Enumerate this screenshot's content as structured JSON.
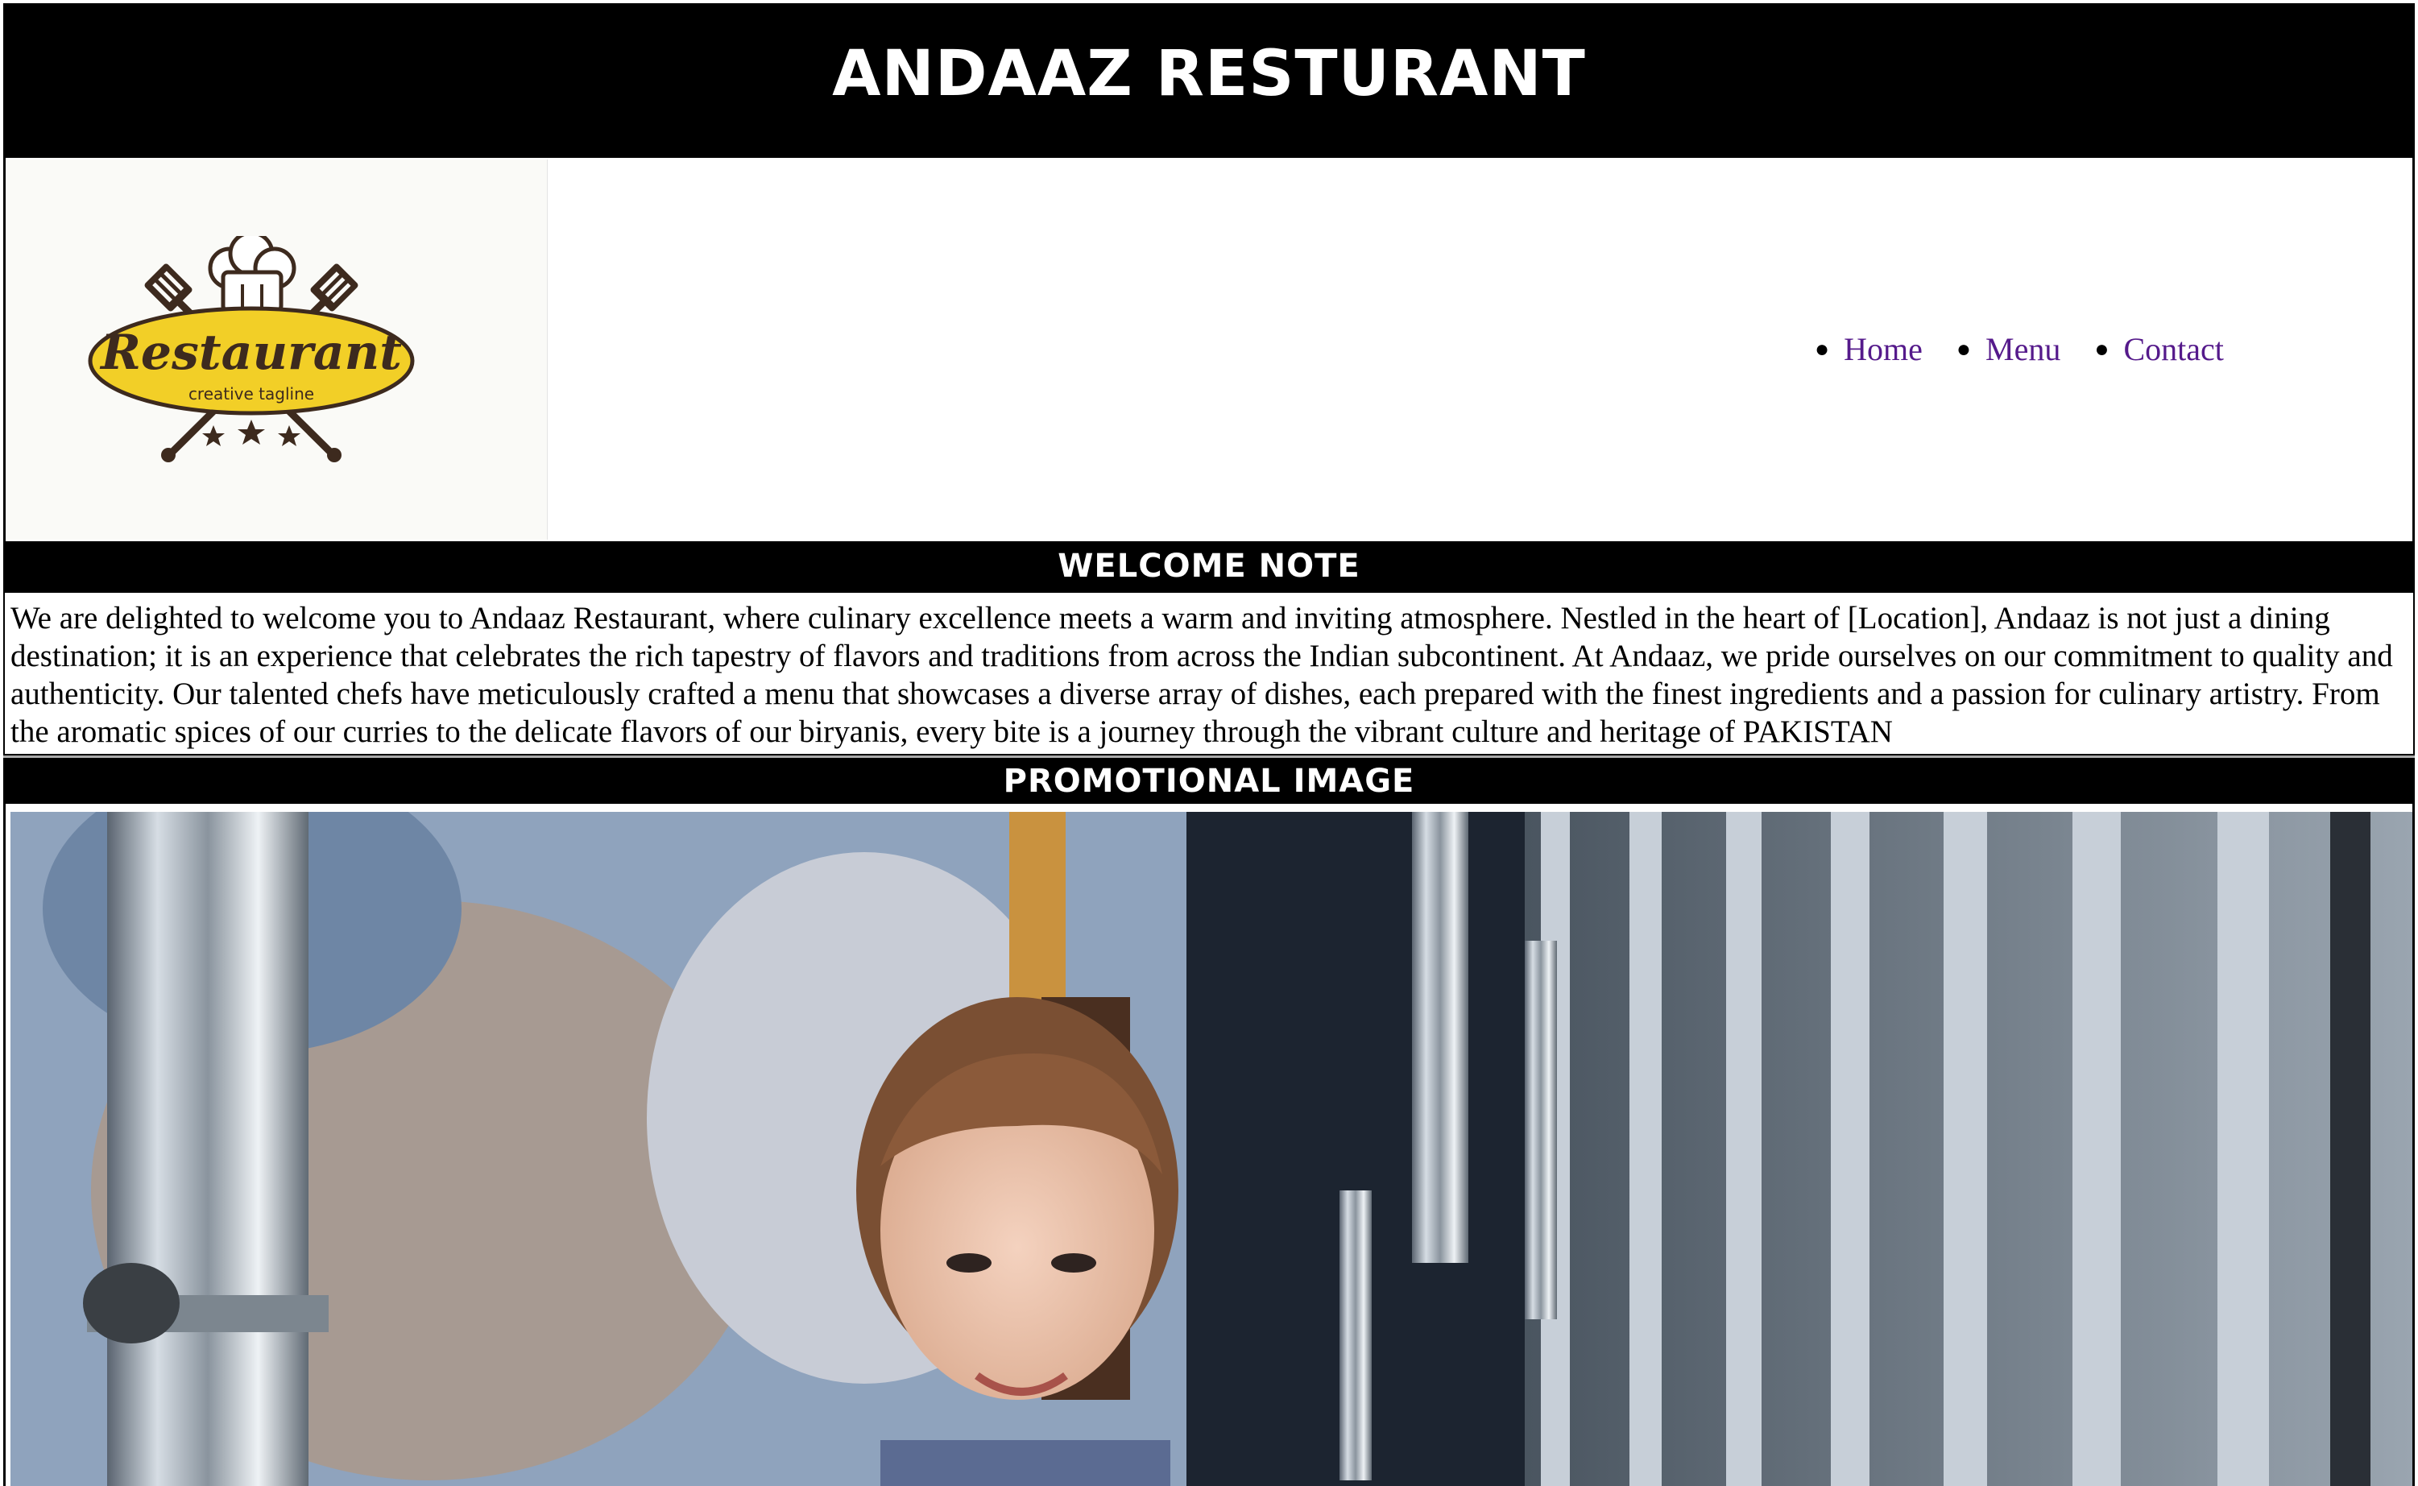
{
  "header": {
    "title": "ANDAAZ RESTURANT"
  },
  "logo": {
    "icon": "chef-hat-logo-icon",
    "text": "Restaurant",
    "tagline": "creative tagline",
    "colors": {
      "badge": "#f2cf27",
      "ink": "#3d2a1e"
    }
  },
  "nav": {
    "items": [
      {
        "label": "Home"
      },
      {
        "label": "Menu"
      },
      {
        "label": "Contact"
      }
    ],
    "link_color": "#551a8b"
  },
  "welcome": {
    "heading": "WELCOME NOTE",
    "body": "We are delighted to welcome you to Andaaz Restaurant, where culinary excellence meets a warm and inviting atmosphere. Nestled in the heart of [Location], Andaaz is not just a dining destination; it is an experience that celebrates the rich tapestry of flavors and traditions from across the Indian subcontinent. At Andaaz, we pride ourselves on our commitment to quality and authenticity. Our talented chefs have meticulously crafted a menu that showcases a diverse array of dishes, each prepared with the finest ingredients and a passion for culinary artistry. From the aromatic spices of our curries to the delicate flavors of our biryanis, every bite is a journey through the vibrant culture and heritage of PAKISTAN"
  },
  "promo": {
    "heading": "PROMOTIONAL IMAGE",
    "image_icon": "promo-photo"
  }
}
